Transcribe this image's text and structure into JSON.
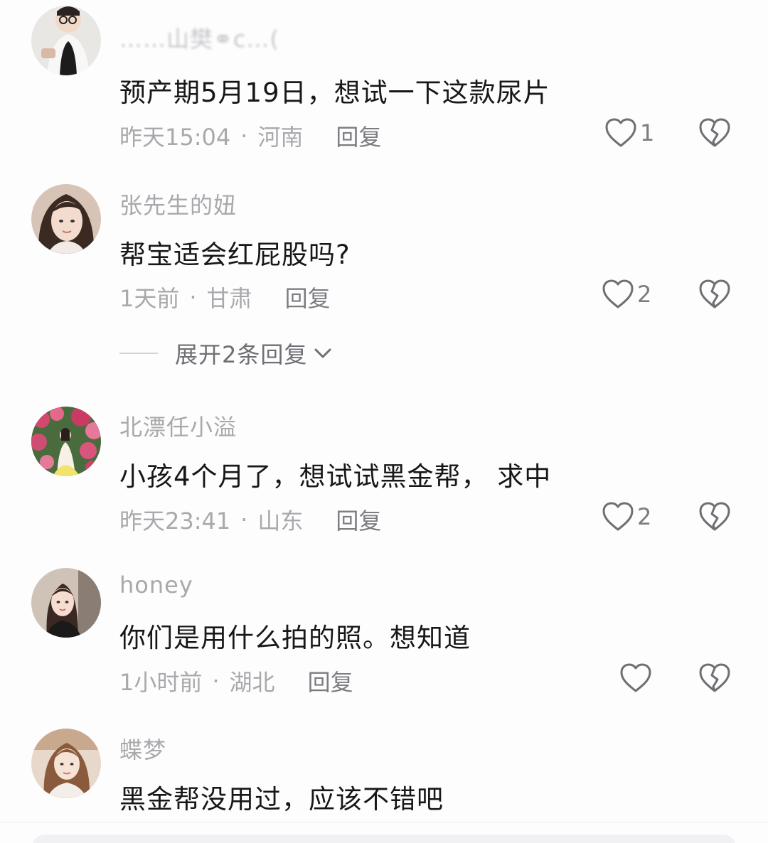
{
  "comments": [
    {
      "username": "……山樊⚭c…(",
      "text": "预产期5月19日，想试一下这款尿片",
      "time": "昨天15:04",
      "location": "河南",
      "reply_label": "回复",
      "likes": "1",
      "avatar_icon": "avatar-child-photo"
    },
    {
      "username": "张先生的妞",
      "text": "帮宝适会红屁股吗?",
      "time": "1天前",
      "location": "甘肃",
      "reply_label": "回复",
      "likes": "2",
      "expand_label": "展开2条回复",
      "avatar_icon": "avatar-woman-photo"
    },
    {
      "username": "北漂任小溢",
      "text": "小孩4个月了，想试试黑金帮， 求中",
      "time": "昨天23:41",
      "location": "山东",
      "reply_label": "回复",
      "likes": "2",
      "avatar_icon": "avatar-flowers-photo"
    },
    {
      "username": "honey",
      "text": "你们是用什么拍的照。想知道",
      "time": "1小时前",
      "location": "湖北",
      "reply_label": "回复",
      "likes": "",
      "avatar_icon": "avatar-woman-photo"
    },
    {
      "username": "蝶梦",
      "text": "黑金帮没用过，应该不错吧",
      "avatar_icon": "avatar-woman-photo"
    }
  ],
  "meta_separator": "·",
  "colors": {
    "text": "#17171a",
    "secondary": "#a9a9ad",
    "action": "#7c7c82",
    "heart": "#6e6e74"
  }
}
